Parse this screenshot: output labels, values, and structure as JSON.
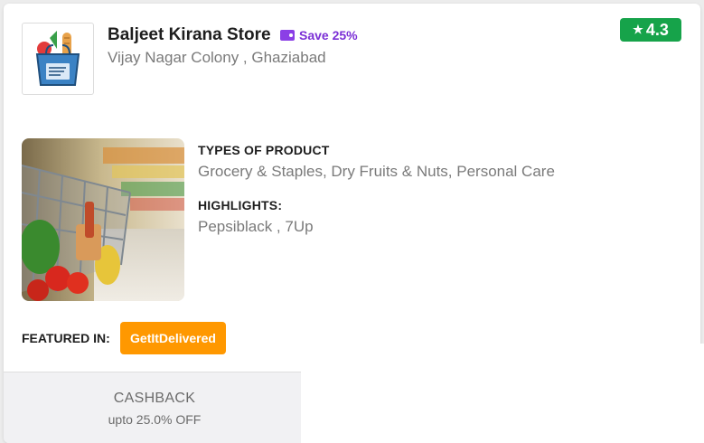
{
  "store": {
    "name": "Baljeet Kirana Store",
    "address": "Vijay Nagar Colony , Ghaziabad",
    "save_label": "Save 25%",
    "rating": "4.3",
    "logo_icon": "grocery-bag-icon"
  },
  "colors": {
    "rating_bg": "#16a34a",
    "save_accent": "#7b2fd6",
    "featured_bg": "#ff9800"
  },
  "details": {
    "types_title": "TYPES OF PRODUCT",
    "types_value": "Grocery & Staples, Dry Fruits & Nuts, Personal Care",
    "highlights_title": "HIGHLIGHTS:",
    "highlights_value": "Pepsiblack , 7Up"
  },
  "featured": {
    "label": "FEATURED IN:",
    "chip": "GetItDelivered"
  },
  "cashback": {
    "title": "CASHBACK",
    "subtitle": "upto 25.0% OFF"
  }
}
